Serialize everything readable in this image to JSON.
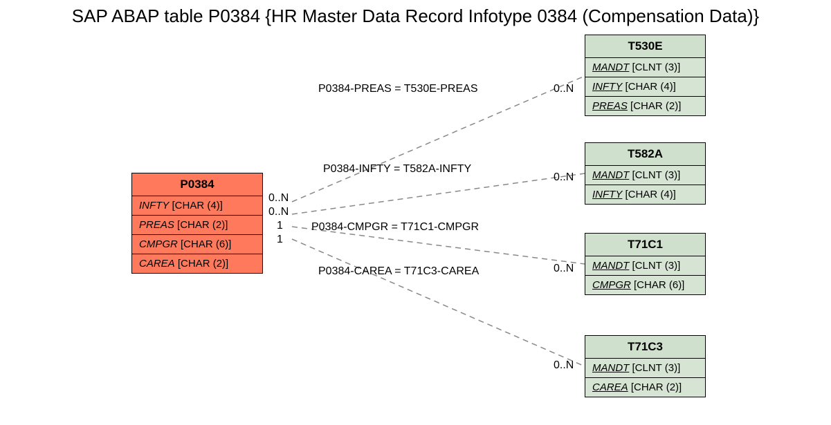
{
  "title": "SAP ABAP table P0384 {HR Master Data Record Infotype 0384 (Compensation Data)}",
  "main": {
    "name": "P0384",
    "fields": [
      {
        "name": "INFTY",
        "type": "[CHAR (4)]"
      },
      {
        "name": "PREAS",
        "type": "[CHAR (2)]"
      },
      {
        "name": "CMPGR",
        "type": "[CHAR (6)]"
      },
      {
        "name": "CAREA",
        "type": "[CHAR (2)]"
      }
    ]
  },
  "refs": {
    "t530e": {
      "name": "T530E",
      "fields": [
        {
          "name": "MANDT",
          "type": "[CLNT (3)]",
          "key": true
        },
        {
          "name": "INFTY",
          "type": "[CHAR (4)]",
          "key": true
        },
        {
          "name": "PREAS",
          "type": "[CHAR (2)]",
          "key": true
        }
      ]
    },
    "t582a": {
      "name": "T582A",
      "fields": [
        {
          "name": "MANDT",
          "type": "[CLNT (3)]",
          "key": true
        },
        {
          "name": "INFTY",
          "type": "[CHAR (4)]",
          "key": true
        }
      ]
    },
    "t71c1": {
      "name": "T71C1",
      "fields": [
        {
          "name": "MANDT",
          "type": "[CLNT (3)]",
          "key": true
        },
        {
          "name": "CMPGR",
          "type": "[CHAR (6)]",
          "key": true
        }
      ]
    },
    "t71c3": {
      "name": "T71C3",
      "fields": [
        {
          "name": "MANDT",
          "type": "[CLNT (3)]",
          "key": true
        },
        {
          "name": "CAREA",
          "type": "[CHAR (2)]",
          "key": true
        }
      ]
    }
  },
  "rels": {
    "r1": {
      "label": "P0384-PREAS = T530E-PREAS",
      "left_card": "0..N",
      "right_card": "0..N"
    },
    "r2": {
      "label": "P0384-INFTY = T582A-INFTY",
      "left_card": "0..N",
      "right_card": "0..N"
    },
    "r3": {
      "label": "P0384-CMPGR = T71C1-CMPGR",
      "left_card": "1",
      "right_card": "0..N"
    },
    "r4": {
      "label": "P0384-CAREA = T71C3-CAREA",
      "left_card": "1",
      "right_card": "0..N"
    }
  }
}
